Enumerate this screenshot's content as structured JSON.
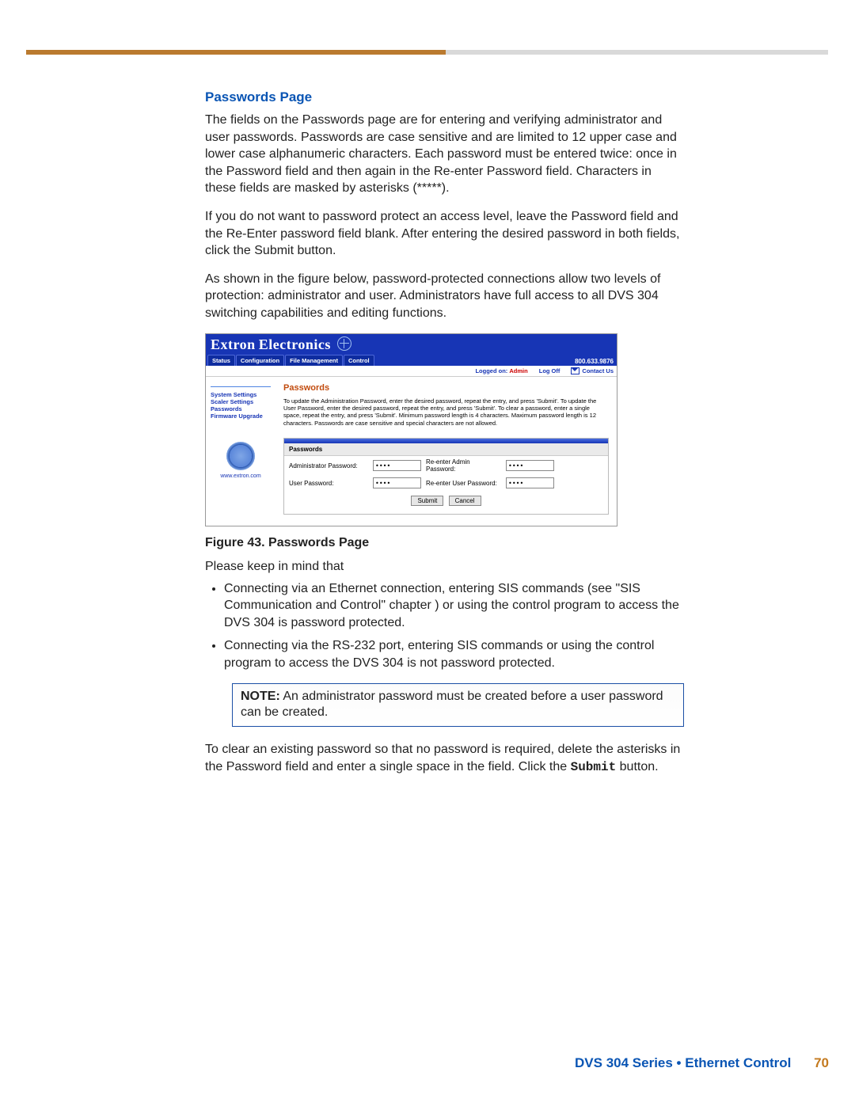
{
  "doc": {
    "heading": "Passwords Page",
    "para1": "The fields on the Passwords page are for entering and verifying administrator and user passwords. Passwords are case sensitive and are limited to 12 upper case and lower case alphanumeric characters. Each password must be entered twice: once in the Password field and then again in the Re-enter Password field. Characters in these fields are masked by asterisks (*****).",
    "para2": "If you do not want to password protect an access level, leave the Password field and the Re-Enter password field blank. After entering the desired password in both fields, click the Submit button.",
    "para3": "As shown in the figure below, password-protected connections allow two levels of protection: administrator and user. Administrators have full access to all DVS 304 switching capabilities and editing functions.",
    "caption_bold": "Figure 43. ",
    "caption_rest": "Passwords Page",
    "after_caption": "Please keep in mind that",
    "bullet1": "Connecting via an Ethernet connection, entering SIS commands (see \"SIS Communication and Control\" chapter ) or using the control program to access the DVS 304 is password protected.",
    "bullet2": "Connecting via the RS-232 port, entering SIS commands or using the control program to access the DVS 304 is not password protected.",
    "note_label": "NOTE:",
    "note_body": " An administrator password must be created before a user password can be created.",
    "para4_a": "To clear an existing password so that no password is required, delete the asterisks in the Password field and enter a single space in the field. Click the ",
    "para4_b": "Submit",
    "para4_c": " button."
  },
  "figure": {
    "brand": "Extron Electronics",
    "tabs": [
      "Status",
      "Configuration",
      "File Management",
      "Control"
    ],
    "phone": "800.633.9876",
    "logged_label": "Logged on:",
    "logged_user": "Admin",
    "logoff": "Log Off",
    "contact": "Contact Us",
    "sidebar_items": [
      "System Settings",
      "Scaler Settings",
      "Passwords",
      "Firmware Upgrade"
    ],
    "site_url": "www.extron.com",
    "page_title": "Passwords",
    "page_desc": "To update the Administration Password, enter the desired password, repeat the entry, and press 'Submit'. To update the User Password, enter the desired password, repeat the entry, and press 'Submit'. To clear a password, enter a single space, repeat the entry, and press 'Submit'. Minimum password length is 4 characters. Maximum password length is 12 characters. Passwords are case sensitive and special characters are not allowed.",
    "panel_label": "Passwords",
    "admin_label": "Administrator Password:",
    "admin_value": "••••",
    "re_admin_label": "Re-enter Admin Password:",
    "re_admin_value": "••••",
    "user_label": "User Password:",
    "user_value": "••••",
    "re_user_label": "Re-enter User Password:",
    "re_user_value": "••••",
    "submit": "Submit",
    "cancel": "Cancel"
  },
  "footer": {
    "text": "DVS 304 Series • Ethernet Control",
    "page": "70"
  }
}
